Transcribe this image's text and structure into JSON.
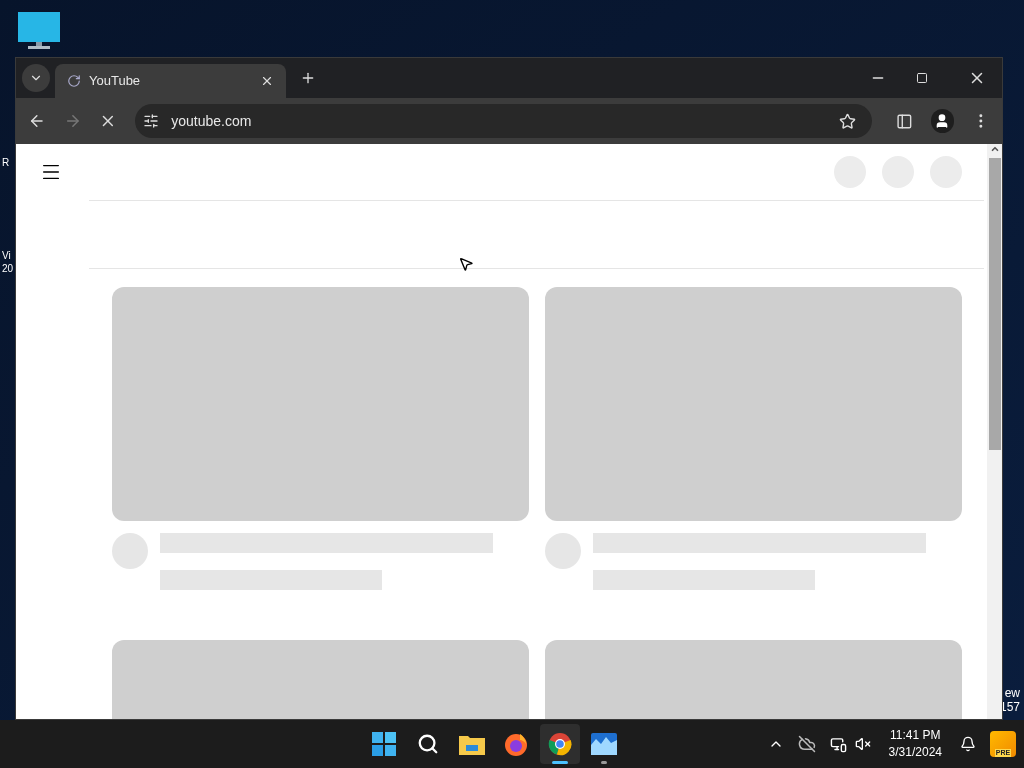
{
  "desktop": {
    "left_fragments": [
      "R",
      "Vi",
      "20"
    ],
    "right_fragments": [
      "ew",
      "157"
    ]
  },
  "browser": {
    "tabs": [
      {
        "title": "YouTube",
        "selected": true
      }
    ],
    "toolbar": {
      "back_disabled": false,
      "forward_disabled": true,
      "loading": true,
      "address": "youtube.com"
    },
    "page": {
      "cards": [
        {
          "kind": "placeholder_with_meta"
        },
        {
          "kind": "placeholder_with_meta"
        },
        {
          "kind": "placeholder"
        },
        {
          "kind": "placeholder"
        }
      ]
    }
  },
  "taskbar": {
    "apps": [
      {
        "kind": "start",
        "running": false,
        "active": false
      },
      {
        "kind": "search",
        "running": false,
        "active": false
      },
      {
        "kind": "files",
        "running": false,
        "active": false
      },
      {
        "kind": "firefox",
        "running": false,
        "active": false
      },
      {
        "kind": "chrome",
        "running": true,
        "active": true
      },
      {
        "kind": "photos",
        "running": true,
        "active": false
      }
    ],
    "time": "11:41 PM",
    "date": "3/31/2024",
    "badge": "PRE"
  }
}
